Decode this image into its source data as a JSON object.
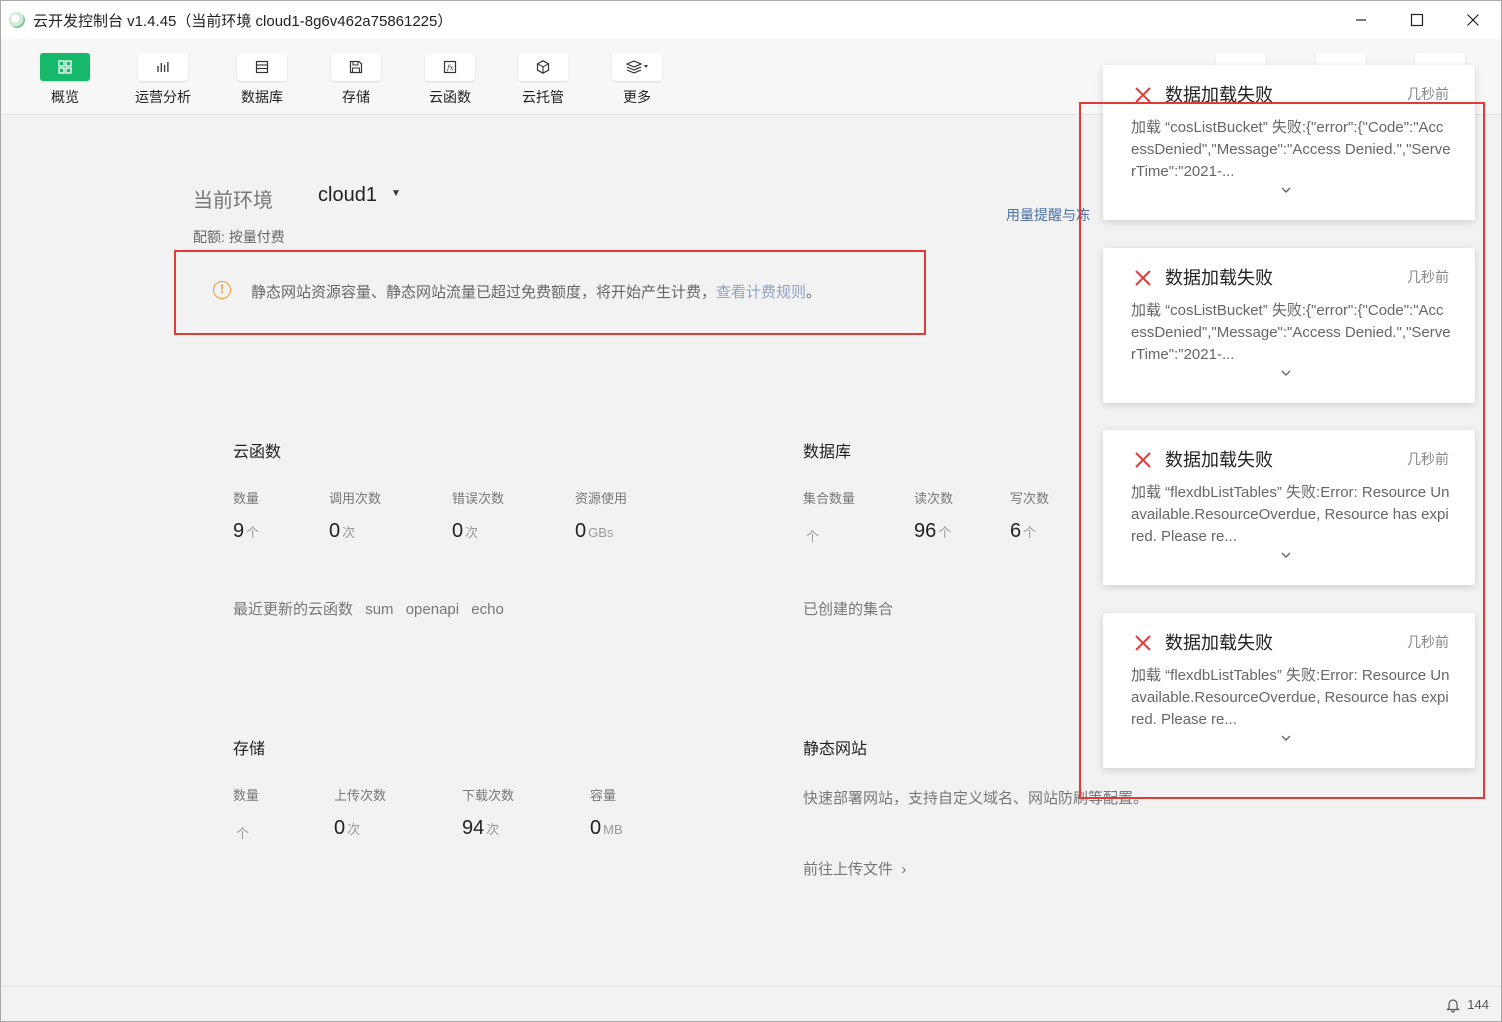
{
  "window": {
    "title": "云开发控制台 v1.4.45（当前环境 cloud1-8g6v462a75861225）"
  },
  "toolbar": {
    "items": [
      {
        "label": "概览",
        "icon": "grid-icon",
        "active": true
      },
      {
        "label": "运营分析",
        "icon": "bar-chart-icon",
        "active": false
      },
      {
        "label": "数据库",
        "icon": "database-icon",
        "active": false
      },
      {
        "label": "存储",
        "icon": "save-icon",
        "active": false
      },
      {
        "label": "云函数",
        "icon": "function-icon",
        "active": false
      },
      {
        "label": "云托管",
        "icon": "cube-icon",
        "active": false
      },
      {
        "label": "更多",
        "icon": "layers-icon",
        "active": false
      }
    ]
  },
  "env": {
    "label": "当前环境",
    "value": "cloud1",
    "quota": "配额: 按量付费",
    "usage_link": "用量提醒与冻"
  },
  "notice": {
    "text": "静态网站资源容量、静态网站流量已超过免费额度，将开始产生计费，",
    "link": "查看计费规则",
    "tail": "。"
  },
  "functions": {
    "title": "云函数",
    "stats": [
      {
        "label": "数量",
        "value": "9",
        "unit": "个"
      },
      {
        "label": "调用次数",
        "value": "0",
        "unit": "次"
      },
      {
        "label": "错误次数",
        "value": "0",
        "unit": "次"
      },
      {
        "label": "资源使用",
        "value": "0",
        "unit": "GBs"
      }
    ],
    "recent_label": "最近更新的云函数",
    "recent": [
      "sum",
      "openapi",
      "echo"
    ]
  },
  "database": {
    "title": "数据库",
    "stats": [
      {
        "label": "集合数量",
        "value": "",
        "unit": "个"
      },
      {
        "label": "读次数",
        "value": "96",
        "unit": "个"
      },
      {
        "label": "写次数",
        "value": "6",
        "unit": "个"
      }
    ],
    "collections_label": "已创建的集合"
  },
  "storage": {
    "title": "存储",
    "stats": [
      {
        "label": "数量",
        "value": "",
        "unit": "个"
      },
      {
        "label": "上传次数",
        "value": "0",
        "unit": "次"
      },
      {
        "label": "下载次数",
        "value": "94",
        "unit": "次"
      },
      {
        "label": "容量",
        "value": "0",
        "unit": "MB"
      }
    ]
  },
  "static_site": {
    "title": "静态网站",
    "desc": "快速部署网站，支持自定义域名、网站防刷等配置。",
    "link": "前往上传文件"
  },
  "toasts": [
    {
      "title": "数据加载失败",
      "time": "几秒前",
      "message": "加载 “cosListBucket” 失败:{\"error\":{\"Code\":\"AccessDenied\",\"Message\":\"Access Denied.\",\"ServerTime\":\"2021-..."
    },
    {
      "title": "数据加载失败",
      "time": "几秒前",
      "message": "加载 “cosListBucket” 失败:{\"error\":{\"Code\":\"AccessDenied\",\"Message\":\"Access Denied.\",\"ServerTime\":\"2021-..."
    },
    {
      "title": "数据加载失败",
      "time": "几秒前",
      "message": "加载 “flexdbListTables” 失败:Error: Resource Unavailable.ResourceOverdue, Resource has expired. Please re..."
    },
    {
      "title": "数据加载失败",
      "time": "几秒前",
      "message": "加载 “flexdbListTables” 失败:Error: Resource Unavailable.ResourceOverdue, Resource has expired. Please re..."
    }
  ],
  "statusbar": {
    "notification_count": "144"
  },
  "colors": {
    "accent": "#16b86a",
    "error": "#e53935",
    "warning": "#f39a2e",
    "link": "#4a6fa5"
  }
}
